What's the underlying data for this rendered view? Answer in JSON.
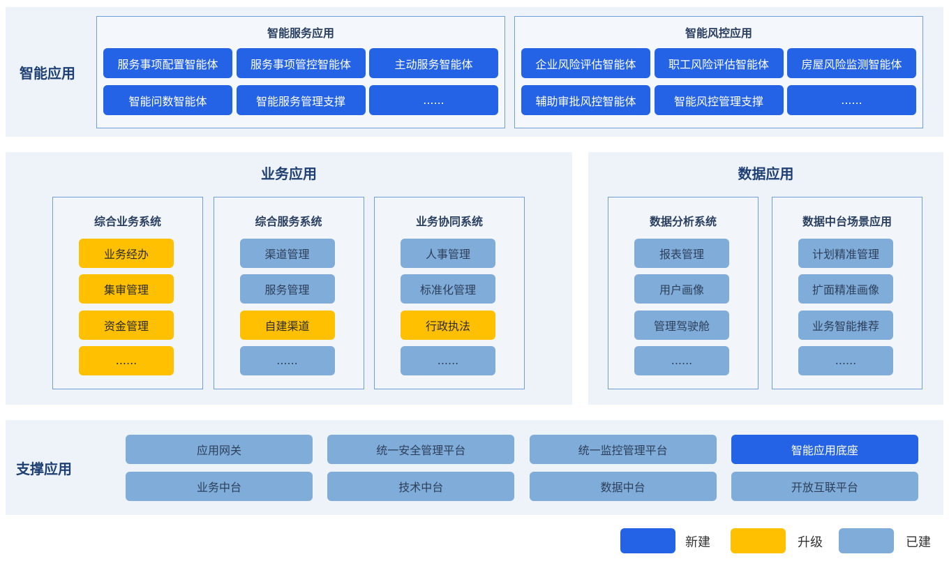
{
  "colors": {
    "new": "#2563e6",
    "upgrade": "#fec000",
    "existing": "#80acd9",
    "band": "#eef3f9"
  },
  "intelligent": {
    "title": "智能应用",
    "service": {
      "title": "智能服务应用",
      "items": [
        {
          "label": "服务事项配置智能体",
          "status": "new"
        },
        {
          "label": "服务事项管控智能体",
          "status": "new"
        },
        {
          "label": "主动服务智能体",
          "status": "new"
        },
        {
          "label": "智能问数智能体",
          "status": "new"
        },
        {
          "label": "智能服务管理支撑",
          "status": "new"
        },
        {
          "label": "......",
          "status": "new"
        }
      ]
    },
    "risk": {
      "title": "智能风控应用",
      "items": [
        {
          "label": "企业风险评估智能体",
          "status": "new"
        },
        {
          "label": "职工风险评估智能体",
          "status": "new"
        },
        {
          "label": "房屋风险监测智能体",
          "status": "new"
        },
        {
          "label": "辅助审批风控智能体",
          "status": "new"
        },
        {
          "label": "智能风控管理支撑",
          "status": "new"
        },
        {
          "label": "......",
          "status": "new"
        }
      ]
    }
  },
  "business": {
    "title": "业务应用",
    "systems": [
      {
        "title": "综合业务系统",
        "items": [
          {
            "label": "业务经办",
            "status": "upgrade"
          },
          {
            "label": "集审管理",
            "status": "upgrade"
          },
          {
            "label": "资金管理",
            "status": "upgrade"
          },
          {
            "label": "......",
            "status": "upgrade"
          }
        ]
      },
      {
        "title": "综合服务系统",
        "items": [
          {
            "label": "渠道管理",
            "status": "existing"
          },
          {
            "label": "服务管理",
            "status": "existing"
          },
          {
            "label": "自建渠道",
            "status": "upgrade"
          },
          {
            "label": "......",
            "status": "existing"
          }
        ]
      },
      {
        "title": "业务协同系统",
        "items": [
          {
            "label": "人事管理",
            "status": "existing"
          },
          {
            "label": "标准化管理",
            "status": "existing"
          },
          {
            "label": "行政执法",
            "status": "upgrade"
          },
          {
            "label": "......",
            "status": "existing"
          }
        ]
      }
    ]
  },
  "data_apps": {
    "title": "数据应用",
    "systems": [
      {
        "title": "数据分析系统",
        "items": [
          {
            "label": "报表管理",
            "status": "existing"
          },
          {
            "label": "用户画像",
            "status": "existing"
          },
          {
            "label": "管理驾驶舱",
            "status": "existing"
          },
          {
            "label": "......",
            "status": "existing"
          }
        ]
      },
      {
        "title": "数据中台场景应用",
        "items": [
          {
            "label": "计划精准管理",
            "status": "existing"
          },
          {
            "label": "扩面精准画像",
            "status": "existing"
          },
          {
            "label": "业务智能推荐",
            "status": "existing"
          },
          {
            "label": "......",
            "status": "existing"
          }
        ]
      }
    ]
  },
  "support": {
    "title": "支撑应用",
    "items": [
      {
        "label": "应用网关",
        "status": "existing"
      },
      {
        "label": "统一安全管理平台",
        "status": "existing"
      },
      {
        "label": "统一监控管理平台",
        "status": "existing"
      },
      {
        "label": "智能应用底座",
        "status": "new"
      },
      {
        "label": "业务中台",
        "status": "existing"
      },
      {
        "label": "技术中台",
        "status": "existing"
      },
      {
        "label": "数据中台",
        "status": "existing"
      },
      {
        "label": "开放互联平台",
        "status": "existing"
      }
    ]
  },
  "legend": [
    {
      "label": "新建",
      "status": "new"
    },
    {
      "label": "升级",
      "status": "upgrade"
    },
    {
      "label": "已建",
      "status": "existing"
    }
  ]
}
